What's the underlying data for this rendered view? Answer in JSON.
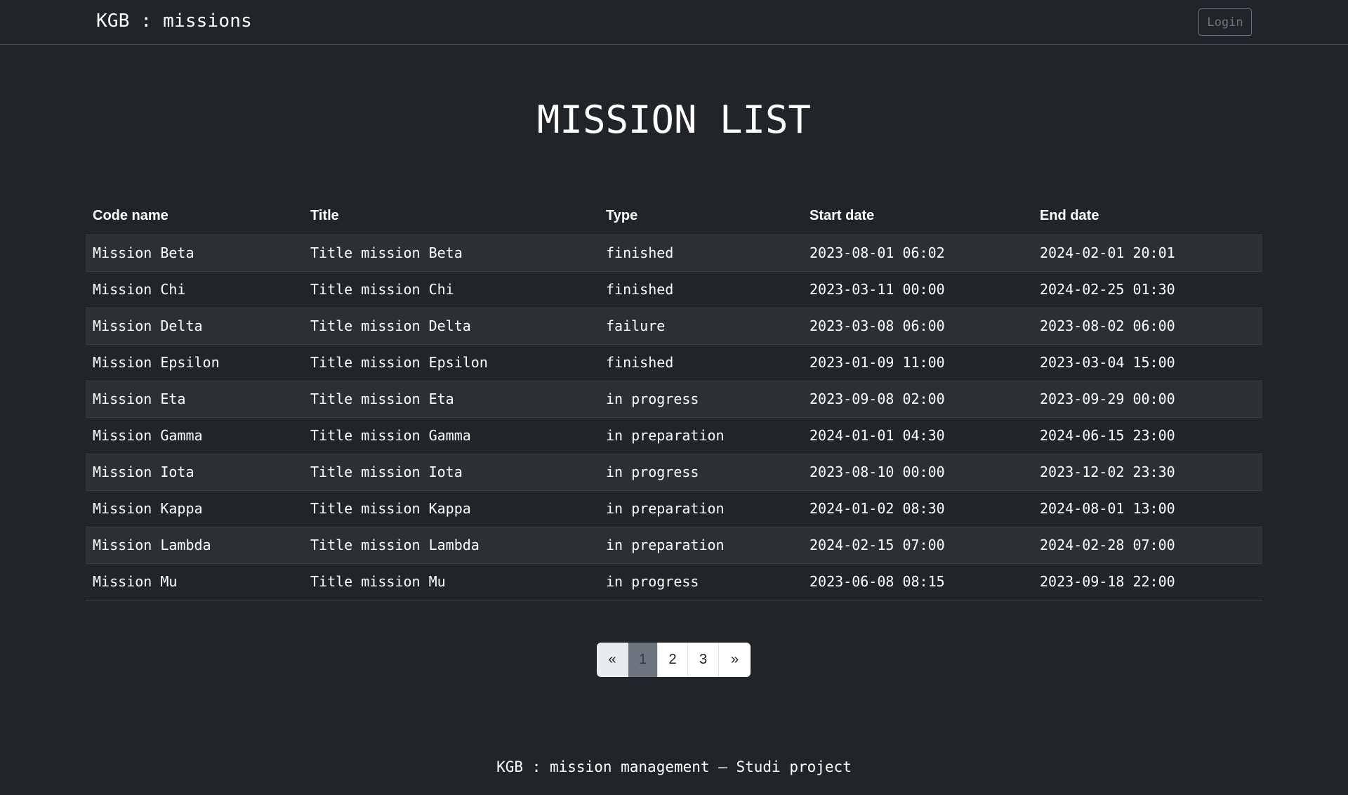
{
  "navbar": {
    "brand": "KGB : missions",
    "login_label": "Login"
  },
  "page": {
    "title": "MISSION LIST"
  },
  "table": {
    "headers": [
      "Code name",
      "Title",
      "Type",
      "Start date",
      "End date"
    ],
    "rows": [
      [
        "Mission Beta",
        "Title mission Beta",
        "finished",
        "2023-08-01 06:02",
        "2024-02-01 20:01"
      ],
      [
        "Mission Chi",
        "Title mission Chi",
        "finished",
        "2023-03-11 00:00",
        "2024-02-25 01:30"
      ],
      [
        "Mission Delta",
        "Title mission Delta",
        "failure",
        "2023-03-08 06:00",
        "2023-08-02 06:00"
      ],
      [
        "Mission Epsilon",
        "Title mission Epsilon",
        "finished",
        "2023-01-09 11:00",
        "2023-03-04 15:00"
      ],
      [
        "Mission Eta",
        "Title mission Eta",
        "in progress",
        "2023-09-08 02:00",
        "2023-09-29 00:00"
      ],
      [
        "Mission Gamma",
        "Title mission Gamma",
        "in preparation",
        "2024-01-01 04:30",
        "2024-06-15 23:00"
      ],
      [
        "Mission Iota",
        "Title mission Iota",
        "in progress",
        "2023-08-10 00:00",
        "2023-12-02 23:30"
      ],
      [
        "Mission Kappa",
        "Title mission Kappa",
        "in preparation",
        "2024-01-02 08:30",
        "2024-08-01 13:00"
      ],
      [
        "Mission Lambda",
        "Title mission Lambda",
        "in preparation",
        "2024-02-15 07:00",
        "2024-02-28 07:00"
      ],
      [
        "Mission Mu",
        "Title mission Mu",
        "in progress",
        "2023-06-08 08:15",
        "2023-09-18 22:00"
      ]
    ]
  },
  "pagination": {
    "prev_label": "«",
    "pages": [
      "1",
      "2",
      "3"
    ],
    "current_page": "1",
    "next_label": "»"
  },
  "footer": {
    "text": "KGB : mission management – Studi project"
  },
  "colors": {
    "background": "#212529",
    "row_stripe": "#2c3034",
    "active_page": "#6c757d",
    "login_outline": "#6c757d"
  }
}
